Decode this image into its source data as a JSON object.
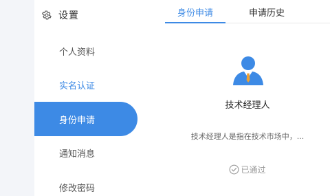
{
  "sidebar": {
    "title": "设置",
    "icon": "gear-icon",
    "items": [
      {
        "label": "个人资料",
        "state": "default"
      },
      {
        "label": "实名认证",
        "state": "link"
      },
      {
        "label": "身份申请",
        "state": "active"
      },
      {
        "label": "通知消息",
        "state": "default"
      },
      {
        "label": "修改密码",
        "state": "default"
      }
    ]
  },
  "tabs": [
    {
      "label": "身份申请",
      "active": true
    },
    {
      "label": "申请历史",
      "active": false
    }
  ],
  "card": {
    "icon": "manager-avatar-icon",
    "title": "技术经理人",
    "description": "技术经理人是指在技术市场中，...",
    "status": "已通过",
    "status_icon": "check-circle-icon"
  },
  "colors": {
    "accent": "#3d8ae5",
    "strip": "#f3f5f9",
    "status_gray": "#9a9a9a"
  }
}
